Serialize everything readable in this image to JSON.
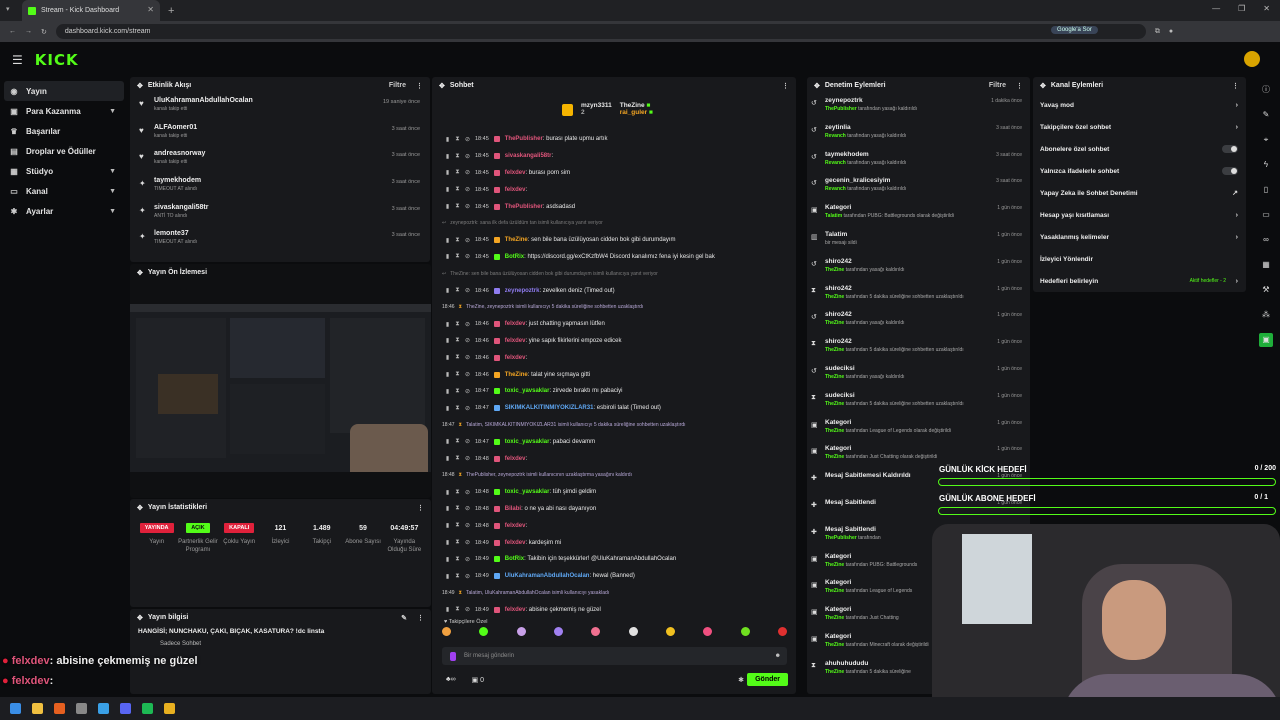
{
  "browser": {
    "tab_title": "Stream - Kick Dashboard",
    "url": "dashboard.kick.com/stream",
    "google_btn": "Google'a Sor"
  },
  "app": {
    "logo": "KICK"
  },
  "sidebar": {
    "items": [
      {
        "label": "Yayın",
        "icon": "broadcast-icon"
      },
      {
        "label": "Para Kazanma",
        "icon": "money-icon"
      },
      {
        "label": "Başarılar",
        "icon": "trophy-icon"
      },
      {
        "label": "Droplar ve Ödüller",
        "icon": "gift-icon"
      },
      {
        "label": "Stüdyo",
        "icon": "studio-icon"
      },
      {
        "label": "Kanal",
        "icon": "channel-icon"
      },
      {
        "label": "Ayarlar",
        "icon": "gear-icon"
      }
    ]
  },
  "activity": {
    "title": "Etkinlik Akışı",
    "filter": "Filtre",
    "items": [
      {
        "name": "UluKahramanAbdullahOcalan",
        "sub": "kanalı takip etti",
        "time": "19 saniye önce"
      },
      {
        "name": "ALFAomer01",
        "sub": "kanalı takip etti",
        "time": "3 saat önce"
      },
      {
        "name": "andreasnorway",
        "sub": "kanalı takip etti",
        "time": "3 saat önce"
      },
      {
        "name": "taymekhodem",
        "sub": "TIMEOUT AT alındı",
        "time": "3 saat önce"
      },
      {
        "name": "sivaskangali58tr",
        "sub": "ANTİ TO alındı",
        "time": "3 saat önce"
      },
      {
        "name": "lemonte37",
        "sub": "TIMEOUT AT alındı",
        "time": "3 saat önce"
      }
    ]
  },
  "preview": {
    "title": "Yayın Ön İzlemesi"
  },
  "stats": {
    "title": "Yayın İstatistikleri",
    "items": [
      {
        "value": "YAYINDA",
        "label": "Yayın"
      },
      {
        "value": "AÇIK",
        "label": "Partnerlik Gelir Programı"
      },
      {
        "value": "KAPALI",
        "label": "Çoklu Yayın"
      },
      {
        "value": "121",
        "label": "İzleyici"
      },
      {
        "value": "1.489",
        "label": "Takipçi"
      },
      {
        "value": "59",
        "label": "Abone Sayısı"
      },
      {
        "value": "04:49:57",
        "label": "Yayında Olduğu Süre"
      }
    ]
  },
  "info": {
    "title": "Yayın bilgisi",
    "stream_title": "HANGİSİ; NUNCHAKU, ÇAKI, BIÇAK, KASATURA? !dc linsta",
    "tag": "Sadece Sohbet"
  },
  "chat": {
    "title": "Sohbet",
    "top_users": [
      {
        "name": "mzyn3311",
        "count": "2"
      },
      {
        "name": "TheZine",
        "count": "2"
      },
      {
        "name": "rai_guler",
        "count": "2"
      }
    ],
    "messages": [
      {
        "type": "msg",
        "time": "18:45",
        "user": "ThePublisher",
        "color": "#e0557b",
        "text": ": burası plate upmu artık"
      },
      {
        "type": "msg",
        "time": "18:45",
        "user": "sivaskangali58tr",
        "color": "#e0557b",
        "text": ":"
      },
      {
        "type": "msg",
        "time": "18:45",
        "user": "felxdev",
        "color": "#e0557b",
        "text": ": burası porn sim"
      },
      {
        "type": "msg",
        "time": "18:45",
        "user": "felxdev",
        "color": "#e0557b",
        "text": ":"
      },
      {
        "type": "msg",
        "time": "18:45",
        "user": "ThePublisher",
        "color": "#e0557b",
        "text": ": asdsadasd"
      },
      {
        "type": "sys",
        "dim": true,
        "text": "zeynepoztrk: sana ilk defa üzüldüm tan isimli kullanıcıya yanıt veriyor"
      },
      {
        "type": "msg",
        "time": "18:45",
        "user": "TheZine",
        "color": "#f5a623",
        "text": ": sen bile bana üzülüyosan cidden bok gibi durumdayım"
      },
      {
        "type": "msg",
        "time": "18:45",
        "user": "BotRix",
        "color": "#53fc18",
        "text": ": https://discord.gg/exCtKzfbW4 Discord kanalımız fena iyi kesin gel bak"
      },
      {
        "type": "sys",
        "dim": true,
        "text": "TheZine: sen bile bana üzülüyosan cidden bok gibi durumdayım isimli kullanıcıya yanıt veriyor"
      },
      {
        "type": "msg",
        "time": "18:46",
        "user": "zeynepoztrk",
        "color": "#8f7cf0",
        "text": ": zevelken deniz (Timed out)"
      },
      {
        "type": "sys",
        "time": "18:46",
        "text": "TheZine, zeynepoztrk isimli kullanıcıyı 5 dakika süreliğine sohbetten uzaklaştırdı"
      },
      {
        "type": "msg",
        "time": "18:46",
        "user": "felxdev",
        "color": "#e0557b",
        "text": ": just chatting yapmasın lütfen"
      },
      {
        "type": "msg",
        "time": "18:46",
        "user": "felxdev",
        "color": "#e0557b",
        "text": ": yine sapık fikirlerini empoze edicek"
      },
      {
        "type": "msg",
        "time": "18:46",
        "user": "felxdev",
        "color": "#e0557b",
        "text": ":"
      },
      {
        "type": "msg",
        "time": "18:46",
        "user": "TheZine",
        "color": "#f5a623",
        "text": ": talat yine sıçmaya gitti"
      },
      {
        "type": "msg",
        "time": "18:47",
        "user": "toxic_yavsaklar",
        "color": "#53fc18",
        "text": ": zirvede bıraktı mı pabaciyi"
      },
      {
        "type": "msg",
        "time": "18:47",
        "user": "SIKIMKALKITINMIYOKIZLAR31",
        "color": "#5fa8f5",
        "text": ": esbiroli talat (Timed out)"
      },
      {
        "type": "sys",
        "time": "18:47",
        "text": "Talatim, SIKIMKALKITINMIYOKIZLAR31 isimli kullanıcıyı 5 dakika süreliğine sohbetten uzaklaştırdı"
      },
      {
        "type": "msg",
        "time": "18:47",
        "user": "toxic_yavsaklar",
        "color": "#53fc18",
        "text": ": pabaci devamm"
      },
      {
        "type": "msg",
        "time": "18:48",
        "user": "felxdev",
        "color": "#e0557b",
        "text": ":"
      },
      {
        "type": "sys",
        "time": "18:48",
        "text": "ThePublisher, zeynepoztrk isimli kullanıcının uzaklaştırma yasağını kaldırdı"
      },
      {
        "type": "msg",
        "time": "18:48",
        "user": "toxic_yavsaklar",
        "color": "#53fc18",
        "text": ": tüh şimdi geldim"
      },
      {
        "type": "msg",
        "time": "18:48",
        "user": "Bilabi",
        "color": "#e0557b",
        "text": ": o ne ya abi nası dayanıyon"
      },
      {
        "type": "msg",
        "time": "18:48",
        "user": "felxdev",
        "color": "#e0557b",
        "text": ":"
      },
      {
        "type": "msg",
        "time": "18:49",
        "user": "felxdev",
        "color": "#e0557b",
        "text": ": kardeşim mi"
      },
      {
        "type": "msg",
        "time": "18:49",
        "user": "BotRix",
        "color": "#53fc18",
        "text": ": Takibin için teşekkürler! @UluKahramanAbdullahOcalan"
      },
      {
        "type": "msg",
        "time": "18:49",
        "user": "UluKahramanAbdullahOcalan",
        "color": "#5fa8f5",
        "text": ": hewal (Banned)"
      },
      {
        "type": "sys",
        "time": "18:49",
        "text": "Talatim, UluKahramanAbdullahOcalan isimli kullanıcıyı yasakladı"
      },
      {
        "type": "msg",
        "time": "18:49",
        "user": "felxdev",
        "color": "#e0557b",
        "text": ": abisine çekmemiş ne güzel"
      },
      {
        "type": "msg",
        "time": "18:49",
        "user": "felxdev",
        "color": "#e0557b",
        "text": ":"
      }
    ],
    "followers_only": "Takipçilere Özel",
    "input_placeholder": "Bir mesaj gönderin",
    "bottom_left_count": "0",
    "send": "Gönder"
  },
  "modlog": {
    "title": "Denetim Eylemleri",
    "filter": "Filtre",
    "items": [
      {
        "icon": "undo-icon",
        "name": "zeynepoztrk",
        "by": "ThePublisher",
        "text": "tarafından yasağı kaldırıldı",
        "time": "1 dakika önce"
      },
      {
        "icon": "undo-icon",
        "name": "zeytinlia",
        "by": "Revanch",
        "text": "tarafından yasağı kaldırıldı",
        "time": "3 saat önce"
      },
      {
        "icon": "undo-icon",
        "name": "taymekhodem",
        "by": "Revanch",
        "text": "tarafından yasağı kaldırıldı",
        "time": "3 saat önce"
      },
      {
        "icon": "undo-icon",
        "name": "gecenin_kralicesiyim",
        "by": "Revanch",
        "text": "tarafından yasağı kaldırıldı",
        "time": "3 saat önce"
      },
      {
        "icon": "category-icon",
        "name": "Kategori",
        "by": "Talatim",
        "text": "tarafından PUBG: Battlegrounds olarak değiştirildi",
        "time": "1 gün önce"
      },
      {
        "icon": "trash-icon",
        "name": "Talatim",
        "by": "",
        "text": "bir mesajı sildi",
        "time": "1 gün önce"
      },
      {
        "icon": "undo-icon",
        "name": "shiro242",
        "by": "TheZine",
        "text": "tarafından yasağı kaldırıldı",
        "time": "1 gün önce"
      },
      {
        "icon": "hourglass-icon",
        "name": "shiro242",
        "by": "TheZine",
        "text": "tarafından 5 dakika süreliğine sohbetten uzaklaştırıldı",
        "time": "1 gün önce"
      },
      {
        "icon": "undo-icon",
        "name": "shiro242",
        "by": "TheZine",
        "text": "tarafından yasağı kaldırıldı",
        "time": "1 gün önce"
      },
      {
        "icon": "hourglass-icon",
        "name": "shiro242",
        "by": "TheZine",
        "text": "tarafından 5 dakika süreliğine sohbetten uzaklaştırıldı",
        "time": "1 gün önce"
      },
      {
        "icon": "undo-icon",
        "name": "sudeciksi",
        "by": "TheZine",
        "text": "tarafından yasağı kaldırıldı",
        "time": "1 gün önce"
      },
      {
        "icon": "hourglass-icon",
        "name": "sudeciksi",
        "by": "TheZine",
        "text": "tarafından 5 dakika süreliğine sohbetten uzaklaştırıldı",
        "time": "1 gün önce"
      },
      {
        "icon": "category-icon",
        "name": "Kategori",
        "by": "TheZine",
        "text": "tarafından League of Legends olarak değiştirildi",
        "time": "1 gün önce"
      },
      {
        "icon": "category-icon",
        "name": "Kategori",
        "by": "TheZine",
        "text": "tarafından Just Chatting olarak değiştirildi",
        "time": "1 gün önce"
      },
      {
        "icon": "pin-icon",
        "name": "Mesaj Sabitlemesi Kaldırıldı",
        "by": "",
        "text": "",
        "time": "1 gün önce"
      },
      {
        "icon": "pin-icon",
        "name": "Mesaj Sabitlendi",
        "by": "",
        "text": "",
        "time": "1 gün önce"
      },
      {
        "icon": "pin-icon",
        "name": "Mesaj Sabitlendi",
        "by": "ThePublisher",
        "text": "tarafından",
        "time": "1 gün önce"
      },
      {
        "icon": "category-icon",
        "name": "Kategori",
        "by": "TheZine",
        "text": "tarafından PUBG: Battlegrounds",
        "time": "1 gün önce"
      },
      {
        "icon": "category-icon",
        "name": "Kategori",
        "by": "TheZine",
        "text": "tarafından League of Legends",
        "time": "1 gün önce"
      },
      {
        "icon": "category-icon",
        "name": "Kategori",
        "by": "TheZine",
        "text": "tarafından Just Chatting",
        "time": "1 gün önce"
      },
      {
        "icon": "category-icon",
        "name": "Kategori",
        "by": "TheZine",
        "text": "tarafından Minecraft olarak değiştirildi",
        "time": "1 gün önce"
      },
      {
        "icon": "hourglass-icon",
        "name": "ahuhuhududu",
        "by": "TheZine",
        "text": "tarafından 5 dakika süreliğine",
        "time": "1 gün önce"
      }
    ]
  },
  "channel": {
    "title": "Kanal Eylemleri",
    "items": [
      {
        "label": "Yavaş mod",
        "control": "arrow"
      },
      {
        "label": "Takipçilere özel sohbet",
        "control": "arrow"
      },
      {
        "label": "Abonelere özel sohbet",
        "control": "toggle"
      },
      {
        "label": "Yalnızca ifadelerle sohbet",
        "control": "toggle"
      },
      {
        "label": "Yapay Zeka ile Sohbet Denetimi",
        "control": "external"
      },
      {
        "label": "Hesap yaşı kısıtlaması",
        "control": "arrow"
      },
      {
        "label": "Yasaklanmış kelimeler",
        "control": "arrow"
      },
      {
        "label": "İzleyici Yönlendir",
        "control": "none"
      },
      {
        "label": "Hedefleri belirleyin",
        "control": "arrow"
      }
    ],
    "goals_status": "Aktif hedefler - 2"
  },
  "goals": [
    {
      "label": "GÜNLÜK KİCK HEDEFİ",
      "progress": "0 / 200"
    },
    {
      "label": "GÜNLÜK ABONE HEDEFİ",
      "progress": "0 / 1"
    }
  ],
  "overlay_chat": [
    {
      "user": "felxdev",
      "text": ": abisine çekmemiş ne güzel"
    },
    {
      "user": "felxdev",
      "text": ":"
    }
  ],
  "colors": {
    "accent": "#53fc18",
    "live": "#e0213b"
  }
}
